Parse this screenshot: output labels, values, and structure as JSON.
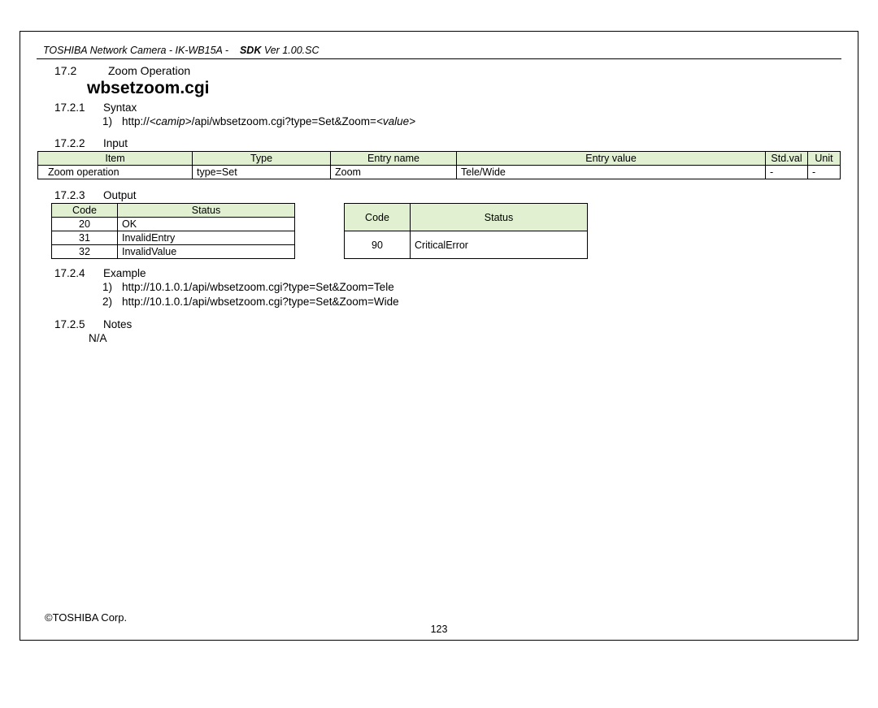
{
  "header": {
    "prefix": "TOSHIBA Network Camera - IK-WB15A -",
    "sdk_label": "SDK",
    "sdk_ver": "Ver 1.00.SC"
  },
  "section": {
    "num": "17.2",
    "title": "Zoom Operation"
  },
  "cgi": "wbsetzoom.cgi",
  "syntax": {
    "num": "17.2.1",
    "label": "Syntax",
    "items": [
      "http://<camip>/api/wbsetzoom.cgi?type=Set&Zoom=<value>"
    ]
  },
  "input": {
    "num": "17.2.2",
    "label": "Input",
    "headers": [
      "Item",
      "Type",
      "Entry name",
      "Entry value",
      "Std.val",
      "Unit"
    ],
    "row": {
      "item": "Zoom operation",
      "type": "type=Set",
      "name": "Zoom",
      "value": "Tele/Wide",
      "std": "-",
      "unit": "-"
    }
  },
  "output": {
    "num": "17.2.3",
    "label": "Output",
    "headers": [
      "Code",
      "Status"
    ],
    "left": [
      {
        "code": "20",
        "status": "OK"
      },
      {
        "code": "31",
        "status": "InvalidEntry"
      },
      {
        "code": "32",
        "status": "InvalidValue"
      }
    ],
    "right": [
      {
        "code": "90",
        "status": "CriticalError"
      }
    ]
  },
  "example": {
    "num": "17.2.4",
    "label": "Example",
    "items": [
      "http://10.1.0.1/api/wbsetzoom.cgi?type=Set&Zoom=Tele",
      "http://10.1.0.1/api/wbsetzoom.cgi?type=Set&Zoom=Wide"
    ]
  },
  "notes": {
    "num": "17.2.5",
    "label": "Notes",
    "body": "N/A"
  },
  "footer": {
    "corp": "©TOSHIBA Corp.",
    "page": "123"
  }
}
